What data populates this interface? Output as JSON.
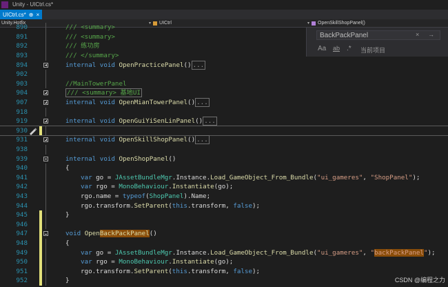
{
  "window": {
    "title": "Unity - UICtrl.cs*"
  },
  "tab": {
    "label": "UICtrl.cs*",
    "pin": "⊕",
    "close": "×"
  },
  "navbar": {
    "project": "Unity.Hotfix",
    "class": "UICtrl",
    "member": "OpenSkillShopPanel()"
  },
  "find": {
    "query": "BackPackPanel",
    "close": "×",
    "next": "→",
    "scope": "当前项目"
  },
  "lines": [
    {
      "n": "890",
      "html": "<span class=\"cm\">/// &lt;summary&gt;</span>",
      "indent": 1
    },
    {
      "n": "891",
      "html": "<span class=\"cm\">/// &lt;summary&gt;</span>",
      "indent": 1
    },
    {
      "n": "892",
      "html": "<span class=\"cm\">/// 练功房</span>",
      "indent": 1
    },
    {
      "n": "893",
      "html": "<span class=\"cm\">/// &lt;/summary&gt;</span>",
      "indent": 1
    },
    {
      "n": "894",
      "html": "<span class=\"kw\">internal void</span> <span class=\"fn\">OpenPracticePanel</span>()<span class=\"box\">...</span>",
      "indent": 1,
      "fold": "plus"
    },
    {
      "n": "902",
      "html": "",
      "indent": 0
    },
    {
      "n": "903",
      "html": "<span class=\"cm\">//MainTowerPanel</span>",
      "indent": 1
    },
    {
      "n": "904",
      "html": "<span class=\"box\"><span class=\"cm\">/// &lt;summary&gt; 基地UI</span></span>",
      "indent": 1,
      "fold": "plus"
    },
    {
      "n": "907",
      "html": "<span class=\"kw\">internal void</span> <span class=\"fn\">OpenMianTowerPanel</span>()<span class=\"box\">...</span>",
      "indent": 1,
      "fold": "plus"
    },
    {
      "n": "918",
      "html": "",
      "indent": 0
    },
    {
      "n": "919",
      "html": "<span class=\"kw\">internal void</span> <span class=\"fn\">OpenGuiYiSenLinPanel</span>()<span class=\"box\">...</span>",
      "indent": 1,
      "fold": "plus"
    },
    {
      "n": "930",
      "html": "",
      "indent": 0,
      "current": true,
      "change": true
    },
    {
      "n": "931",
      "html": "<span class=\"kw\">internal void</span> <span class=\"fn\">OpenSkillShopPanel</span>()<span class=\"box\">...</span>",
      "indent": 1,
      "fold": "plus"
    },
    {
      "n": "938",
      "html": "",
      "indent": 0
    },
    {
      "n": "939",
      "html": "<span class=\"kw\">internal void</span> <span class=\"fn\">OpenShopPanel</span>()",
      "indent": 1,
      "fold": "minus"
    },
    {
      "n": "940",
      "html": "{",
      "indent": 1
    },
    {
      "n": "941",
      "html": "<span class=\"kw\">var</span> go = <span class=\"ty\">JAssetBundleMgr</span>.Instance.<span class=\"fn\">Load_GameObject_From_Bundle</span>(<span class=\"st\">\"ui_gameres\"</span>, <span class=\"st\">\"ShopPanel\"</span>);",
      "indent": 2
    },
    {
      "n": "942",
      "html": "<span class=\"kw\">var</span> rgo = <span class=\"ty\">MonoBehaviour</span>.<span class=\"fn\">Instantiate</span>(go);",
      "indent": 2
    },
    {
      "n": "943",
      "html": "rgo.name = <span class=\"kw\">typeof</span>(<span class=\"ty\">ShopPanel</span>).Name;",
      "indent": 2
    },
    {
      "n": "944",
      "html": "rgo.transform.<span class=\"fn\">SetParent</span>(<span class=\"kw\">this</span>.transform, <span class=\"kw\">false</span>);",
      "indent": 2
    },
    {
      "n": "945",
      "html": "}",
      "indent": 1,
      "change": true
    },
    {
      "n": "946",
      "html": "",
      "indent": 0,
      "change": true
    },
    {
      "n": "947",
      "html": "<span class=\"kw\">void</span> <span class=\"fn\">Open<span class=\"hl\">BackPackPanel</span></span>()",
      "indent": 1,
      "fold": "minus",
      "change": true
    },
    {
      "n": "948",
      "html": "{",
      "indent": 1,
      "change": true
    },
    {
      "n": "949",
      "html": "<span class=\"kw\">var</span> go = <span class=\"ty\">JAssetBundleMgr</span>.Instance.<span class=\"fn\">Load_GameObject_From_Bundle</span>(<span class=\"st\">\"ui_gameres\"</span>, <span class=\"st\">\"<span class=\"hl\">backPackPanel</span>\"</span>);",
      "indent": 2,
      "change": true
    },
    {
      "n": "950",
      "html": "<span class=\"kw\">var</span> rgo = <span class=\"ty\">MonoBehaviour</span>.<span class=\"fn\">Instantiate</span>(go);",
      "indent": 2,
      "change": true
    },
    {
      "n": "951",
      "html": "rgo.transform.<span class=\"fn\">SetParent</span>(<span class=\"kw\">this</span>.transform, <span class=\"kw\">false</span>);",
      "indent": 2,
      "change": true
    },
    {
      "n": "952",
      "html": "}",
      "indent": 1,
      "change": true
    }
  ],
  "watermark": "CSDN @编程之力"
}
